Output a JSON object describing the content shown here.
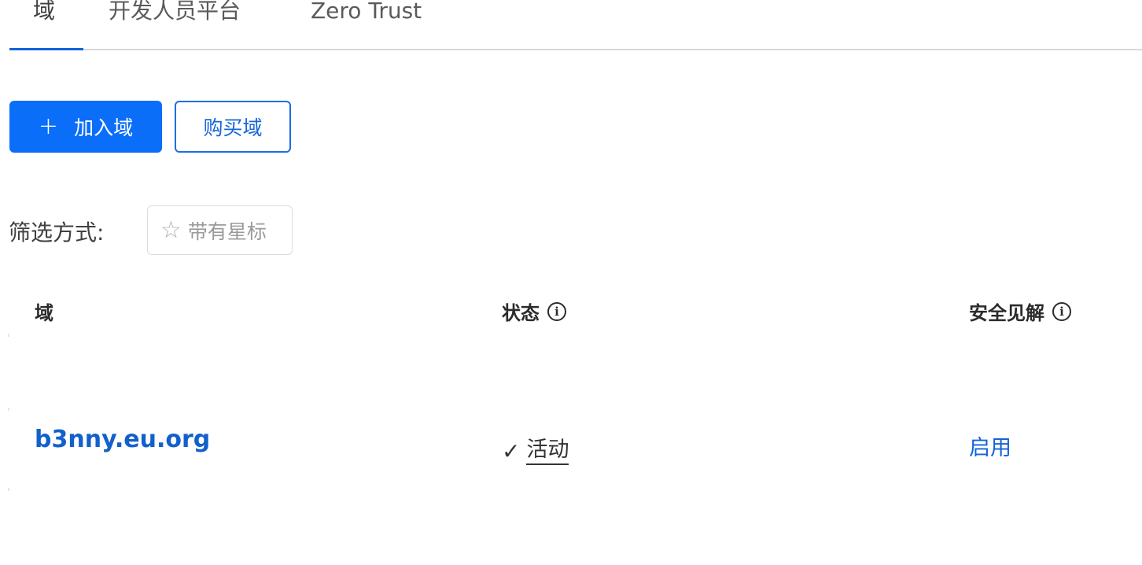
{
  "tabs": [
    {
      "label": "域"
    },
    {
      "label": "开发人员平台"
    },
    {
      "label": "Zero Trust"
    }
  ],
  "actions": {
    "add_domain_label": "加入域",
    "buy_domain_label": "购买域"
  },
  "filter": {
    "label": "筛选方式:",
    "starred_label": "带有星标"
  },
  "table": {
    "headers": {
      "domain": "域",
      "status": "状态",
      "insights": "安全见解"
    },
    "rows": [
      {
        "domain": "b3nny.eu.org",
        "status": "活动",
        "insights": "启用"
      }
    ]
  },
  "colors": {
    "primary": "#0b6ef9",
    "link": "#1260cc",
    "tab_active": "#1463d8"
  },
  "icons": {
    "add": "plus-icon",
    "star": "star-outline-icon",
    "info": "info-circle-icon",
    "check": "check-icon"
  }
}
